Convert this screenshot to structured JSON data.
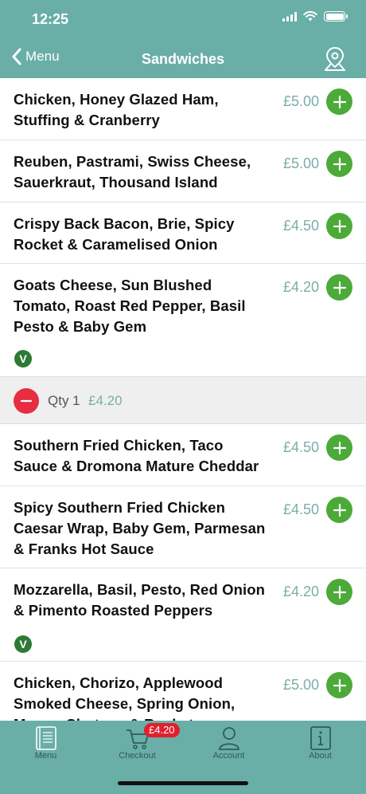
{
  "status": {
    "time": "12:25"
  },
  "nav": {
    "back_label": "Menu",
    "title": "Sandwiches"
  },
  "items": [
    {
      "name": "Chicken, Honey Glazed Ham, Stuffing & Cranberry",
      "price": "£5.00",
      "vegetarian": false
    },
    {
      "name": "Reuben, Pastrami, Swiss Cheese, Sauerkraut, Thousand Island",
      "price": "£5.00",
      "vegetarian": false
    },
    {
      "name": "Crispy Back Bacon, Brie, Spicy Rocket & Caramelised Onion",
      "price": "£4.50",
      "vegetarian": false
    },
    {
      "name": "Goats Cheese, Sun Blushed Tomato, Roast Red Pepper, Basil Pesto & Baby Gem",
      "price": "£4.20",
      "vegetarian": true,
      "veg_label": "V"
    },
    {
      "name": "Southern Fried Chicken, Taco Sauce & Dromona Mature Cheddar",
      "price": "£4.50",
      "vegetarian": false
    },
    {
      "name": "Spicy Southern Fried Chicken Caesar Wrap, Baby Gem, Parmesan & Franks Hot Sauce",
      "price": "£4.50",
      "vegetarian": false
    },
    {
      "name": "Mozzarella, Basil, Pesto, Red Onion & Pimento Roasted Peppers",
      "price": "£4.20",
      "vegetarian": true,
      "veg_label": "V"
    },
    {
      "name": "Chicken, Chorizo, Applewood Smoked Cheese, Spring Onion, Mango Chutney & Rocket",
      "price": "£5.00",
      "vegetarian": false
    }
  ],
  "quantity_row": {
    "qty_label": "Qty 1",
    "price": "£4.20"
  },
  "tabbar": {
    "menu": "Menu",
    "checkout": "Checkout",
    "checkout_badge": "£4.20",
    "account": "Account",
    "about": "About"
  },
  "colors": {
    "header": "#6aaea8",
    "add": "#4caa38",
    "remove": "#e72d42",
    "price": "#7aaea8",
    "veg": "#2e7a34"
  }
}
